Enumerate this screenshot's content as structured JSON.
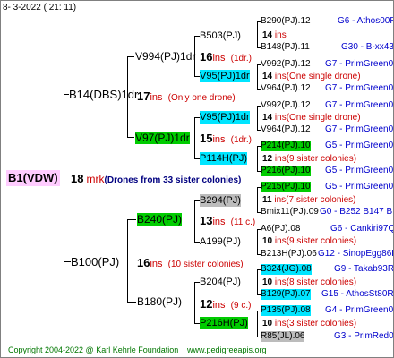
{
  "header": {
    "date": "8-  3-2022 ( 21: 11)"
  },
  "root": {
    "label": "B1(VDW)"
  },
  "gen1": {
    "num": "18",
    "mrk": "mrk",
    "note": "(Drones from 33 sister colonies)",
    "upper": "B14(DBS)1dr",
    "lower": "B100(PJ)"
  },
  "g2": {
    "upper_ins_n": "17",
    "upper_ins": "ins",
    "upper_note": "(Only one drone)",
    "lower_ins_n": "16",
    "lower_ins": "ins",
    "lower_note": "(10 sister colonies)"
  },
  "g3": {
    "a": "V994(PJ)1dr",
    "b": "V97(PJ)1dr",
    "b_ins_n": "15",
    "b_ins": "ins",
    "b_note": "(1dr.)",
    "c": "B240(PJ)",
    "c_ins_n": "13",
    "c_ins": "ins",
    "c_note": "(11 c.)",
    "d": "B180(PJ)",
    "d_ins_n": "12",
    "d_ins": "ins",
    "d_note": "(9 c.)"
  },
  "g4": {
    "a1": "B503(PJ)",
    "a_ins_n": "16",
    "a_ins": "ins",
    "a_note": "(1dr.)",
    "a2": "V95(PJ)1dr",
    "b1": "V95(PJ)1dr",
    "b2": "P114H(PJ)",
    "c1": "B294(PJ)",
    "c2": "A199(PJ)",
    "d1": "B204(PJ)",
    "d2": "P216H(PJ)"
  },
  "g5": [
    {
      "name": "B290(PJ).12",
      "info": "G6 - Athos00R"
    },
    {
      "num": "14",
      "ins": "ins",
      "note": ""
    },
    {
      "name": "B148(PJ).11",
      "info": "G30 - B-xx43"
    },
    {
      "name": "V992(PJ).12",
      "info": "G7 - PrimGreen00"
    },
    {
      "num": "14",
      "ins": "ins",
      "note": "(One single drone)"
    },
    {
      "name": "V964(PJ).12",
      "info": "G7 - PrimGreen00"
    },
    {
      "name": "V992(PJ).12",
      "info": "G7 - PrimGreen00"
    },
    {
      "num": "14",
      "ins": "ins",
      "note": "(One single drone)"
    },
    {
      "name": "V964(PJ).12",
      "info": "G7 - PrimGreen00"
    },
    {
      "name": "P214(PJ).10",
      "info": "G5 - PrimGreen00"
    },
    {
      "num": "12",
      "ins": "ins",
      "note": "(9 sister colonies)"
    },
    {
      "name": "P216(PJ).10",
      "info": "G5 - PrimGreen00"
    },
    {
      "name": "P215(PJ).10",
      "info": "G5 - PrimGreen00"
    },
    {
      "num": "11",
      "ins": "ins",
      "note": "(7 sister colonies)"
    },
    {
      "name": "Bmix11(PJ).09",
      "info": "G0 - B252 B147 B"
    },
    {
      "name": "A6(PJ).08",
      "info": "G6 - Cankiri97Q"
    },
    {
      "num": "10",
      "ins": "ins",
      "note": "(9 sister colonies)"
    },
    {
      "name": "B213H(PJ).06",
      "info": "G12 - SinopEgg86R"
    },
    {
      "name": "B324(JG).08",
      "info": "G9 - Takab93R"
    },
    {
      "num": "10",
      "ins": "ins",
      "note": "(8 sister colonies)"
    },
    {
      "name": "B129(PJ).07",
      "info": "G15 - AthosSt80R"
    },
    {
      "name": "P135(PJ).08",
      "info": "G4 - PrimGreen00"
    },
    {
      "num": "10",
      "ins": "ins",
      "note": "(3 sister colonies)"
    },
    {
      "name": "R85(JL).06",
      "info": "G3 - PrimRed01"
    }
  ],
  "footer": {
    "copyright": "Copyright 2004-2022 @ Karl Kehrle Foundation",
    "site": "www.pedigreeapis.org"
  }
}
